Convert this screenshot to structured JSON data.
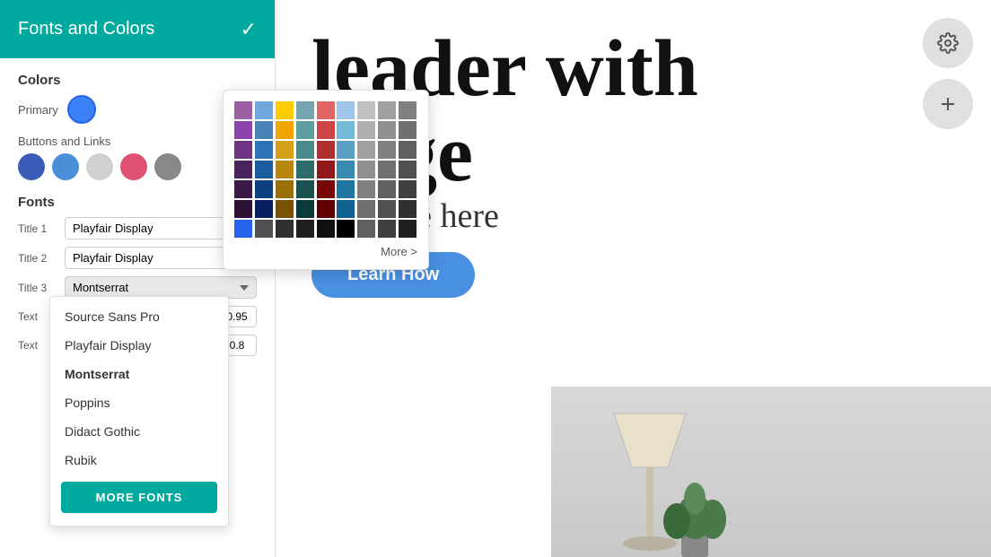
{
  "panel": {
    "title": "Fonts and Colors",
    "check_label": "✓"
  },
  "colors_section": {
    "label": "Colors",
    "primary_label": "Primary",
    "buttons_links_label": "Buttons and  Links",
    "swatches": [
      {
        "color": "#3b5cb8",
        "name": "blue-dark"
      },
      {
        "color": "#4a90d9",
        "name": "blue-mid"
      },
      {
        "color": "#d0d0d0",
        "name": "gray"
      },
      {
        "color": "#e05070",
        "name": "pink"
      },
      {
        "color": "#888888",
        "name": "gray-dark"
      }
    ]
  },
  "fonts_section": {
    "label": "Fonts",
    "rows": [
      {
        "label": "Title 1",
        "font": "Playfair Display",
        "size": null
      },
      {
        "label": "Title 2",
        "font": "Playfair Display",
        "size": null
      },
      {
        "label": "Title 3",
        "font": "Montserrat",
        "size": null
      },
      {
        "label": "Text",
        "size": "0.95"
      },
      {
        "label": "Text",
        "size": "0.8"
      }
    ]
  },
  "font_dropdown": {
    "items": [
      {
        "label": "Source Sans Pro",
        "active": false
      },
      {
        "label": "Playfair Display",
        "active": false
      },
      {
        "label": "Montserrat",
        "active": true
      },
      {
        "label": "Poppins",
        "active": false
      },
      {
        "label": "Didact Gothic",
        "active": false
      },
      {
        "label": "Rubik",
        "active": false
      }
    ],
    "more_fonts_btn": "MORE FONTS"
  },
  "color_picker": {
    "more_label": "More >",
    "colors": [
      "#9c5fa3",
      "#6fa8dc",
      "#ffcc00",
      "#76a5af",
      "#e06666",
      "#9fc5e8",
      "#c0c0c0",
      "#a0a0a0",
      "#808080",
      "#8e44ad",
      "#4682b4",
      "#f0a500",
      "#5f9ea0",
      "#cc4444",
      "#74b9d6",
      "#b0b0b0",
      "#909090",
      "#707070",
      "#6c3483",
      "#2e75b6",
      "#d4a017",
      "#4a8a8a",
      "#b03030",
      "#5a9ec4",
      "#a0a0a0",
      "#808080",
      "#606060",
      "#4a235a",
      "#1c5c9e",
      "#b8860b",
      "#2e6b6b",
      "#901818",
      "#3a8ab0",
      "#909090",
      "#707070",
      "#505050",
      "#3b1a48",
      "#0d4080",
      "#9a6f08",
      "#1a5252",
      "#780808",
      "#2076a0",
      "#808080",
      "#606060",
      "#404040",
      "#2d1235",
      "#082060",
      "#7a5206",
      "#0a3a3a",
      "#600000",
      "#106090",
      "#707070",
      "#505050",
      "#303030",
      "#2463eb",
      "#505050",
      "#303030",
      "#202020",
      "#101010",
      "#000000",
      "#606060",
      "#404040",
      "#202020"
    ]
  },
  "hero": {
    "title_line1": "leader with",
    "title_line2": "nage",
    "subtitle": "r subtitle here",
    "cta_button": "Learn How"
  },
  "right_buttons": {
    "settings_icon": "⚙",
    "add_icon": "+"
  }
}
